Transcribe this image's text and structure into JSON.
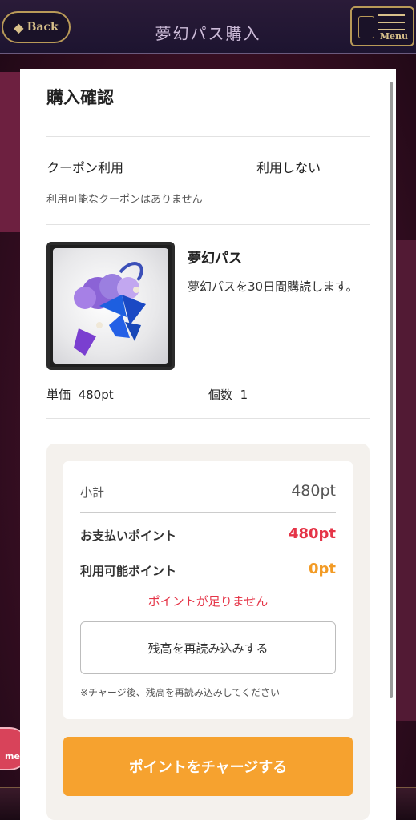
{
  "header": {
    "back_label": "Back",
    "title": "夢幻パス購入",
    "menu_label": "Menu"
  },
  "modal": {
    "title": "購入確認",
    "coupon": {
      "label": "クーポン利用",
      "value": "利用しない",
      "note": "利用可能なクーポンはありません"
    },
    "product": {
      "name": "夢幻パス",
      "description": "夢幻パスを30日間購読します。",
      "unit_price_label": "単価",
      "unit_price": "480pt",
      "quantity_label": "個数",
      "quantity": "1"
    },
    "summary": {
      "subtotal_label": "小計",
      "subtotal_value": "480pt",
      "payment_label": "お支払いポイント",
      "payment_value": "480pt",
      "available_label": "利用可能ポイント",
      "available_value": "0pt",
      "warning": "ポイントが足りません",
      "reload_button": "残高を再読み込みする",
      "reload_note": "※チャージ後、残高を再読み込みしてください"
    },
    "charge_button": "ポイントをチャージする"
  },
  "colors": {
    "accent_orange": "#f6a22f",
    "alert_red": "#e53447",
    "available_orange": "#f29b26"
  }
}
